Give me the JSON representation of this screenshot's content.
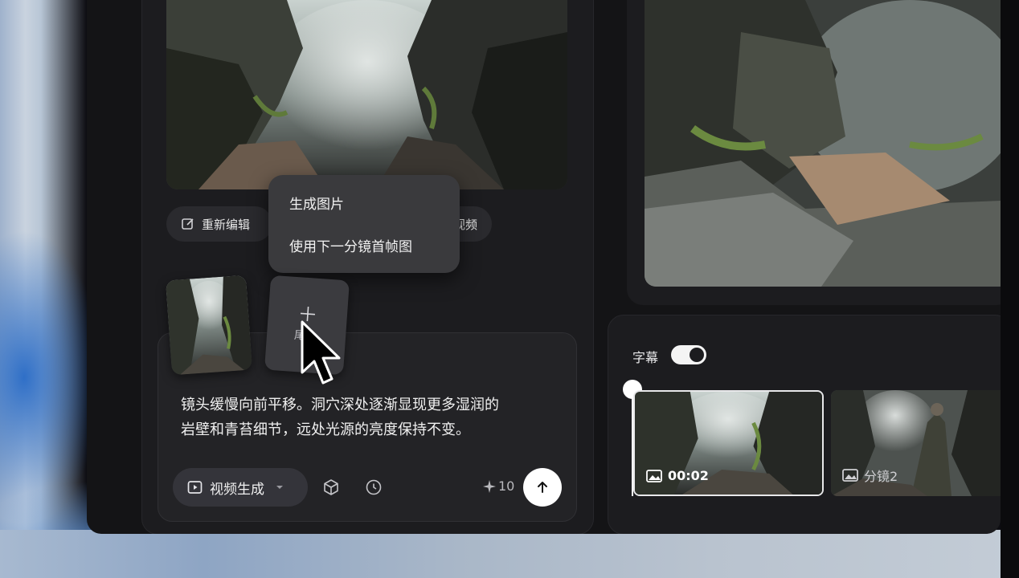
{
  "preview_actions": {
    "re_edit_label": "重新编辑",
    "video_partial_label": "视频"
  },
  "context_menu": {
    "items": [
      "生成图片",
      "使用下一分镜首帧图"
    ]
  },
  "add_card": {
    "partial_label": "尾"
  },
  "prompt": {
    "text_line1": "镜头缓慢向前平移。洞穴深处逐渐显现更多湿润的",
    "text_line2": "岩壁和青苔细节，远处光源的亮度保持不变。",
    "mode_label": "视频生成",
    "credits": "10"
  },
  "timeline": {
    "subtitle_label": "字幕",
    "subtitle_enabled": true,
    "clips": [
      {
        "label": "00:02"
      },
      {
        "label": "分镜2"
      }
    ]
  },
  "icons": {
    "edit": "edit-icon",
    "video": "video-icon",
    "cube": "cube-icon",
    "history": "clock-icon",
    "credits": "sparkle-icon",
    "send": "arrow-up-icon",
    "image": "image-icon",
    "dropdown": "chevron-down-icon",
    "add": "plus-icon",
    "cursor": "mouse-cursor-icon"
  },
  "colors": {
    "panel": "#1c1c1f",
    "menu": "#3a3a3d",
    "accent": "#ffffff"
  }
}
